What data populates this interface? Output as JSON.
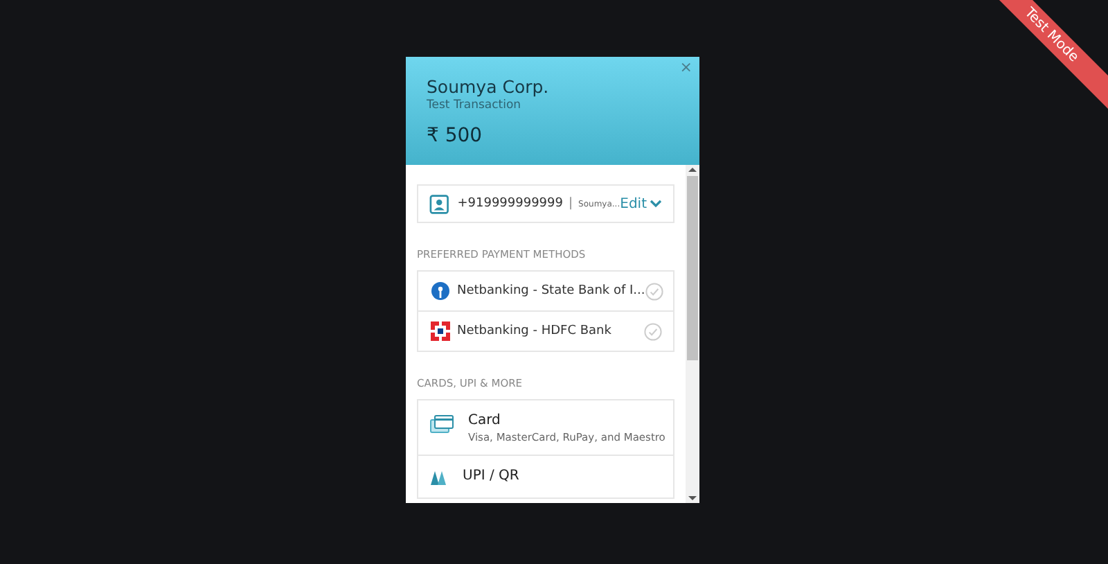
{
  "ribbon": {
    "label": "Test Mode"
  },
  "header": {
    "merchant": "Soumya Corp.",
    "description": "Test Transaction",
    "amount": "₹ 500",
    "close": "×"
  },
  "contact": {
    "phone": "+919999999999",
    "separator": "|",
    "name": "Soumya...",
    "edit": "Edit"
  },
  "preferred": {
    "title": "PREFERRED PAYMENT METHODS",
    "items": [
      {
        "kind": "sbi",
        "label": "Netbanking - State Bank of I...",
        "selected": false
      },
      {
        "kind": "hdfc",
        "label": "Netbanking - HDFC Bank",
        "selected": false
      }
    ]
  },
  "more": {
    "title": "CARDS, UPI & MORE",
    "items": [
      {
        "kind": "card",
        "title": "Card",
        "subtitle": "Visa, MasterCard, RuPay, and Maestro"
      },
      {
        "kind": "upi",
        "title": "UPI / QR"
      }
    ]
  }
}
